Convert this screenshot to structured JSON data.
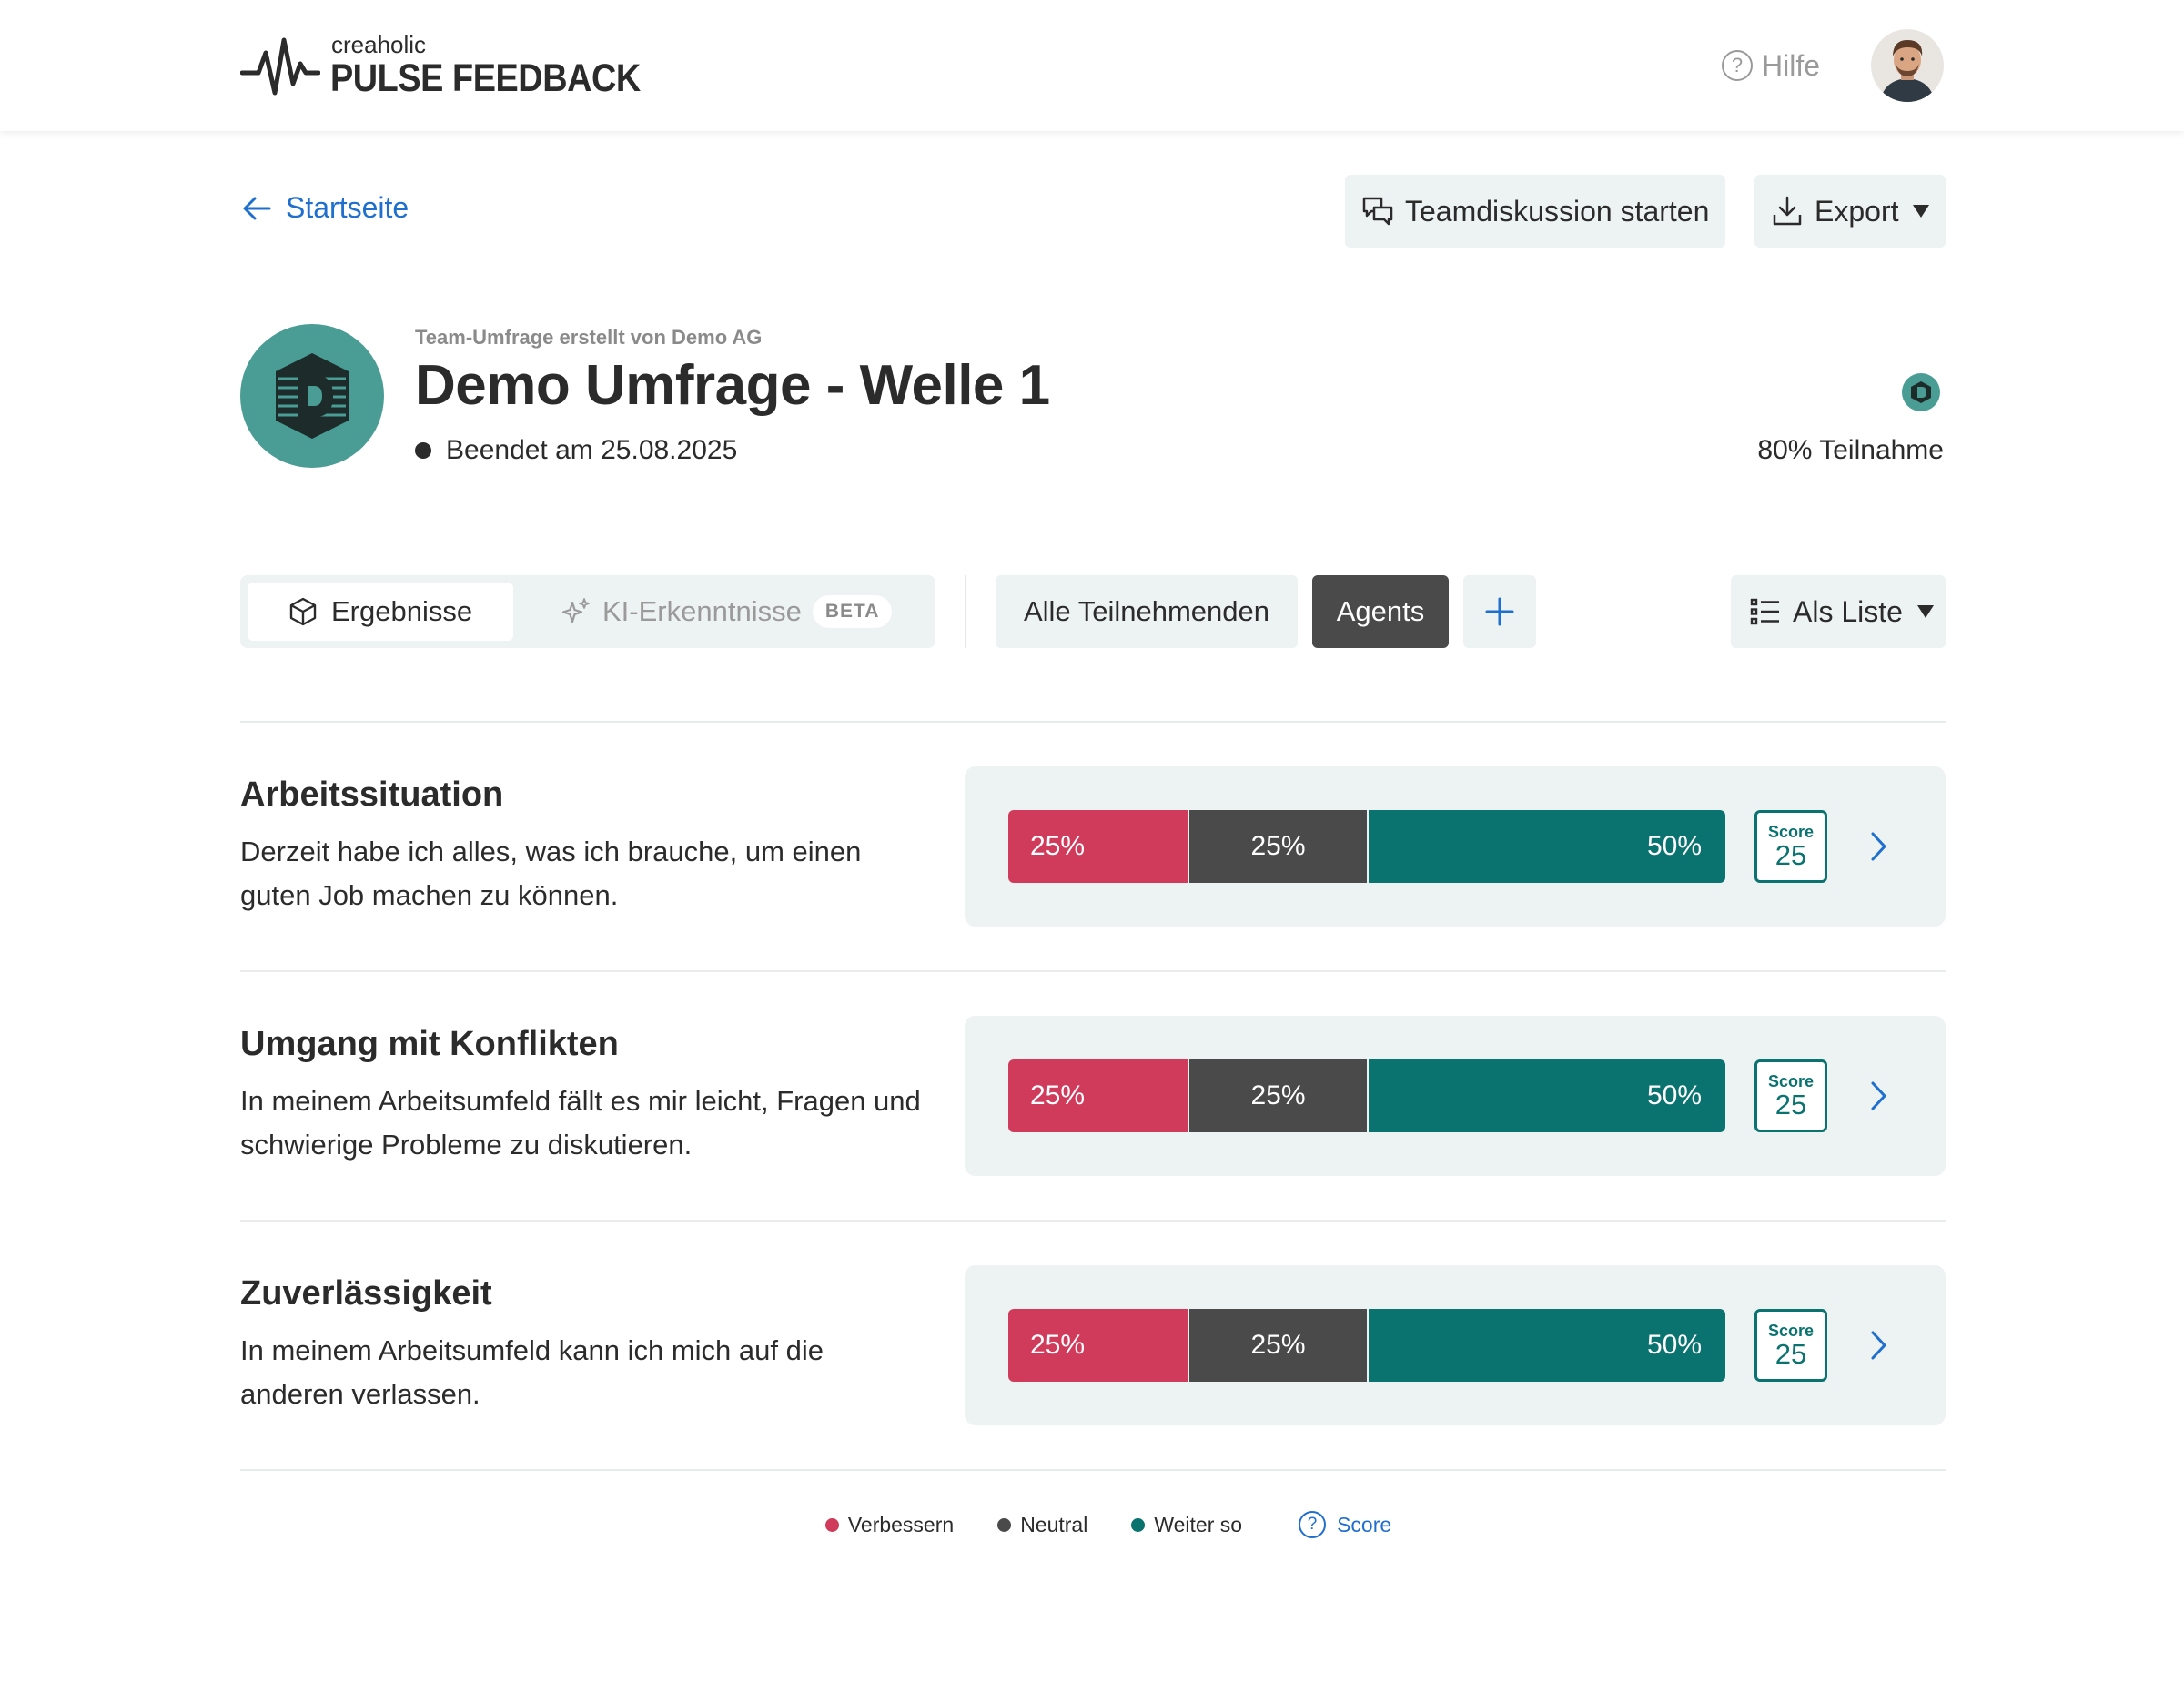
{
  "app": {
    "brand_small": "creaholic",
    "brand_name": "PULSE FEEDBACK",
    "help_label": "Hilfe"
  },
  "nav": {
    "back_label": "Startseite",
    "team_discussion_label": "Teamdiskussion starten",
    "export_label": "Export"
  },
  "survey": {
    "created_by": "Team-Umfrage erstellt von Demo AG",
    "title": "Demo Umfrage - Welle 1",
    "status": "Beendet am 25.08.2025",
    "participation": "80% Teilnahme"
  },
  "controls": {
    "tab_results": "Ergebnisse",
    "tab_ai": "KI-Erkenntnisse",
    "tab_ai_badge": "BETA",
    "filter_all": "Alle Teilnehmenden",
    "filter_agents": "Agents",
    "view_label": "Als Liste"
  },
  "questions": [
    {
      "title": "Arbeitssituation",
      "text": "Derzeit habe ich alles, was ich brauche, um einen guten Job machen zu können.",
      "improve": "25%",
      "neutral": "25%",
      "keep": "50%",
      "improve_value": 25,
      "neutral_value": 25,
      "keep_value": 50,
      "score_label": "Score",
      "score": "25"
    },
    {
      "title": "Umgang mit Konflikten",
      "text": "In meinem Arbeitsumfeld fällt es mir leicht, Fragen und schwierige Probleme zu diskutieren.",
      "improve": "25%",
      "neutral": "25%",
      "keep": "50%",
      "improve_value": 25,
      "neutral_value": 25,
      "keep_value": 50,
      "score_label": "Score",
      "score": "25"
    },
    {
      "title": "Zuverlässigkeit",
      "text": "In meinem Arbeitsumfeld kann ich mich auf die anderen verlassen.",
      "improve": "25%",
      "neutral": "25%",
      "keep": "50%",
      "improve_value": 25,
      "neutral_value": 25,
      "keep_value": 50,
      "score_label": "Score",
      "score": "25"
    }
  ],
  "legend": {
    "improve": "Verbessern",
    "neutral": "Neutral",
    "keep": "Weiter so",
    "score": "Score"
  },
  "colors": {
    "improve": "#d13b5b",
    "neutral": "#4a4a4a",
    "keep": "#0a7370",
    "accent_link": "#1f6fcf",
    "brand_teal": "#4a9d94"
  },
  "icons": {
    "back": "arrow-left-icon",
    "help": "help-circle-icon",
    "team_discussion": "chat-bubbles-icon",
    "export": "download-icon",
    "results_tab": "cube-icon",
    "ai_tab": "sparkles-icon",
    "add_filter": "plus-icon",
    "view": "list-icon",
    "row_open": "chevron-right-icon"
  }
}
